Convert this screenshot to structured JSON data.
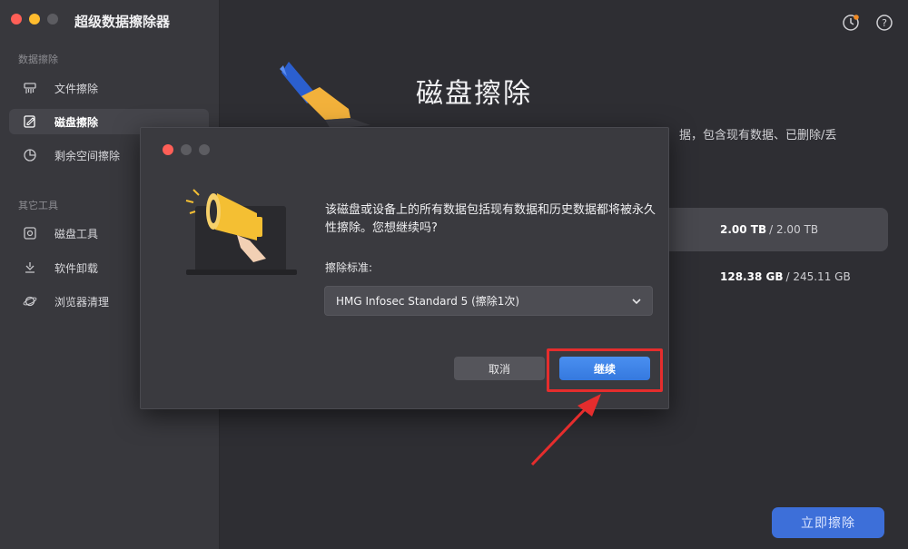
{
  "app": {
    "title": "超级数据擦除器"
  },
  "sidebar": {
    "section1": "数据擦除",
    "section2": "其它工具",
    "items": [
      {
        "label": "文件擦除",
        "icon": "shredder-icon"
      },
      {
        "label": "磁盘擦除",
        "icon": "disk-edit-icon",
        "active": true
      },
      {
        "label": "剩余空间擦除",
        "icon": "pie-chart-icon"
      },
      {
        "label": "磁盘工具",
        "icon": "disk-tool-icon"
      },
      {
        "label": "软件卸载",
        "icon": "uninstall-icon"
      },
      {
        "label": "浏览器清理",
        "icon": "planet-icon"
      }
    ]
  },
  "main": {
    "title": "磁盘擦除",
    "desc_fragment": "据，包含现有数据、已删除/丢",
    "disks": [
      {
        "used": "2.00 TB",
        "total": "/ 2.00 TB",
        "selected": true
      },
      {
        "used": "128.38 GB",
        "total": "/ 245.11 GB",
        "selected": false
      }
    ],
    "erase_button": "立即擦除"
  },
  "dialog": {
    "message": "该磁盘或设备上的所有数据包括现有数据和历史数据都将被永久性擦除。您想继续吗?",
    "standard_label": "擦除标准:",
    "standard_value": "HMG Infosec Standard 5 (擦除1次)",
    "cancel": "取消",
    "continue": "继续"
  },
  "colors": {
    "accent": "#3d6fd9",
    "highlight": "#e52d2d"
  }
}
